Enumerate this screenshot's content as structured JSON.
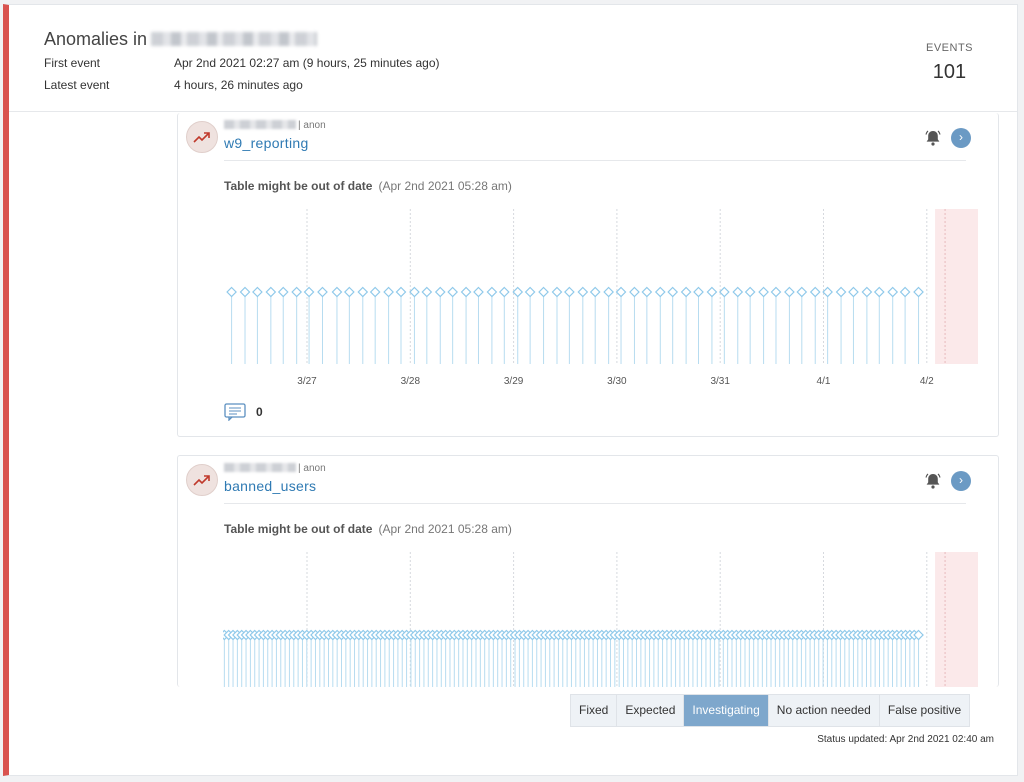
{
  "header": {
    "title": "Anomalies in",
    "first_event_label": "First event",
    "first_event_value": "Apr 2nd 2021 02:27 am (9 hours, 25 minutes ago)",
    "latest_event_label": "Latest event",
    "latest_event_value": "4 hours, 26 minutes ago",
    "events_label": "EVENTS",
    "events_count": "101"
  },
  "anomalies": [
    {
      "owner": "anon",
      "table": "w9_reporting",
      "alert": "Table might be out of date",
      "alert_time": "(Apr 2nd 2021 05:28 am)",
      "comments": "0",
      "chart_data": {
        "type": "scatter",
        "title": "",
        "x_ticks": [
          "3/27",
          "3/28",
          "3/29",
          "3/30",
          "3/31",
          "4/1",
          "4/2"
        ],
        "x_domain": [
          0,
          6.35
        ],
        "x_tick_positions": [
          0,
          1,
          2,
          3,
          4,
          5,
          6
        ],
        "anomaly_start": 6.08,
        "marker": "diamond",
        "grid": true,
        "series": [
          {
            "x": [
              -0.73,
              -0.6,
              -0.48,
              -0.35,
              -0.23,
              -0.1,
              0.02,
              0.15,
              0.29,
              0.41,
              0.54,
              0.66,
              0.79,
              0.91,
              1.04,
              1.16,
              1.29,
              1.41,
              1.54,
              1.66,
              1.79,
              1.91,
              2.04,
              2.16,
              2.29,
              2.42,
              2.54,
              2.67,
              2.79,
              2.92,
              3.04,
              3.17,
              3.29,
              3.42,
              3.54,
              3.67,
              3.79,
              3.92,
              4.04,
              4.17,
              4.29,
              4.42,
              4.54,
              4.67,
              4.79,
              4.92,
              5.04,
              5.17,
              5.29,
              5.42,
              5.54,
              5.67,
              5.79,
              5.92
            ]
          }
        ]
      }
    },
    {
      "owner": "anon",
      "table": "banned_users",
      "alert": "Table might be out of date",
      "alert_time": "(Apr 2nd 2021 05:28 am)",
      "chart_data": {
        "type": "scatter",
        "title": "",
        "x_domain": [
          0,
          6.35
        ],
        "x_tick_positions": [
          0,
          1,
          2,
          3,
          4,
          5,
          6
        ],
        "anomaly_start": 6.08,
        "marker": "diamond",
        "grid": true,
        "series": [
          {
            "range": [
              -0.8,
              5.95
            ],
            "step": 0.042
          }
        ]
      }
    }
  ],
  "status": {
    "options": [
      "Fixed",
      "Expected",
      "Investigating",
      "No action needed",
      "False positive"
    ],
    "selected": "Investigating",
    "updated": "Status updated: Apr 2nd 2021 02:40 am"
  }
}
